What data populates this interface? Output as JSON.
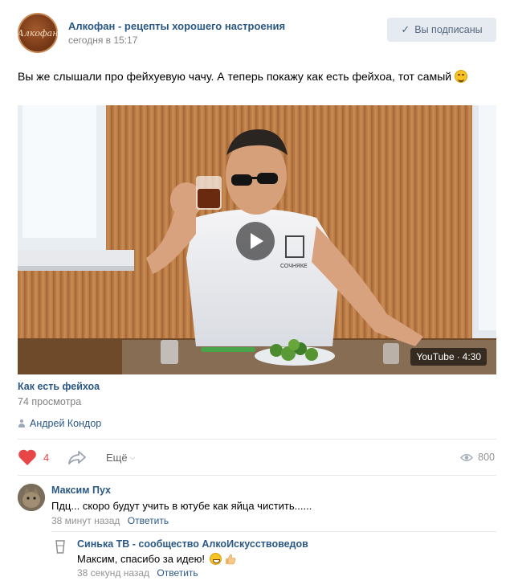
{
  "post": {
    "group_name": "Алкофан - рецепты хорошего настроения",
    "avatar_text": "Алкофан",
    "time": "сегодня в 15:17",
    "subscribed_label": "Вы подписаны",
    "text": "Вы же слышали про фейхуевую чачу. А теперь покажу как есть фейхоа, тот самый"
  },
  "video": {
    "source": "YouTube",
    "duration": "4:30",
    "title": "Как есть фейхоа",
    "views": "74 просмотра",
    "author": "Андрей Кондор",
    "shirt_text": "СОЧНЯКЕ"
  },
  "actions": {
    "like_count": "4",
    "more_label": "Ещё",
    "views_count": "800"
  },
  "comments": [
    {
      "author": "Максим Пух",
      "text": "Пдц... скоро будут учить в ютубе как яйца чистить......",
      "time": "38 минут назад",
      "reply_label": "Ответить"
    },
    {
      "author": "Синька ТВ - сообщество АлкоИскусствоведов",
      "text": "Максим, спасибо за идею!",
      "time": "38 секунд назад",
      "reply_label": "Ответить"
    }
  ],
  "colors": {
    "link": "#2a5885",
    "like": "#e64646",
    "muted": "#828282",
    "button_bg": "#e5ebf1"
  }
}
